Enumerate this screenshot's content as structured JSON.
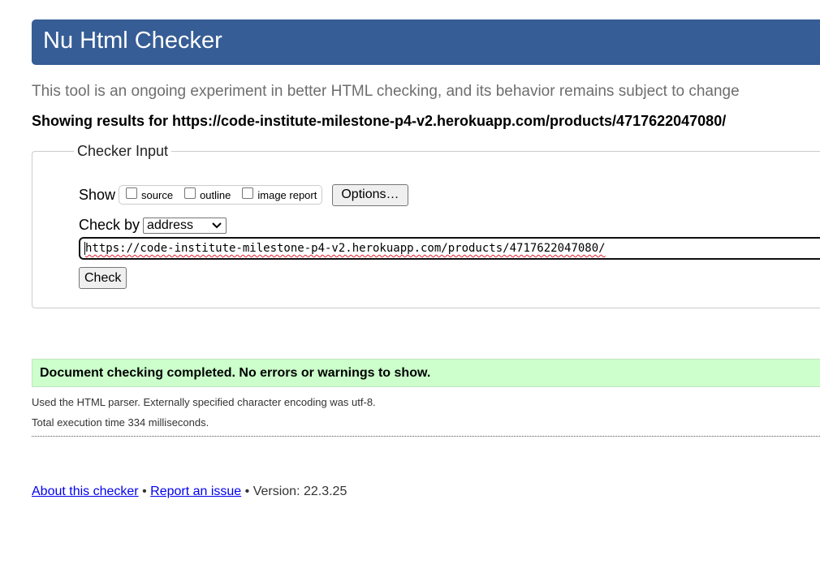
{
  "header": {
    "title": "Nu Html Checker"
  },
  "intro": {
    "tagline": "This tool is an ongoing experiment in better HTML checking, and its behavior remains subject to change",
    "results_for": "Showing results for https://code-institute-milestone-p4-v2.herokuapp.com/products/4717622047080/"
  },
  "checker_input": {
    "legend": "Checker Input",
    "show_label": "Show",
    "show_options": [
      {
        "label": "source",
        "checked": false
      },
      {
        "label": "outline",
        "checked": false
      },
      {
        "label": "image report",
        "checked": false
      }
    ],
    "options_button": "Options…",
    "check_by_label": "Check by",
    "check_by_selected": "address",
    "url_value": "https://code-institute-milestone-p4-v2.herokuapp.com/products/4717622047080/",
    "check_button": "Check"
  },
  "result": {
    "message": "Document checking completed. No errors or warnings to show.",
    "parser_info": "Used the HTML parser. Externally specified character encoding was utf-8.",
    "execution_time": "Total execution time 334 milliseconds."
  },
  "footer": {
    "about_link": "About this checker",
    "separator": "•",
    "report_link": "Report an issue",
    "version": "• Version: 22.3.25"
  },
  "colors": {
    "header_bg": "#365d95",
    "success_bg": "#ccffcc",
    "link": "#0000ee"
  }
}
